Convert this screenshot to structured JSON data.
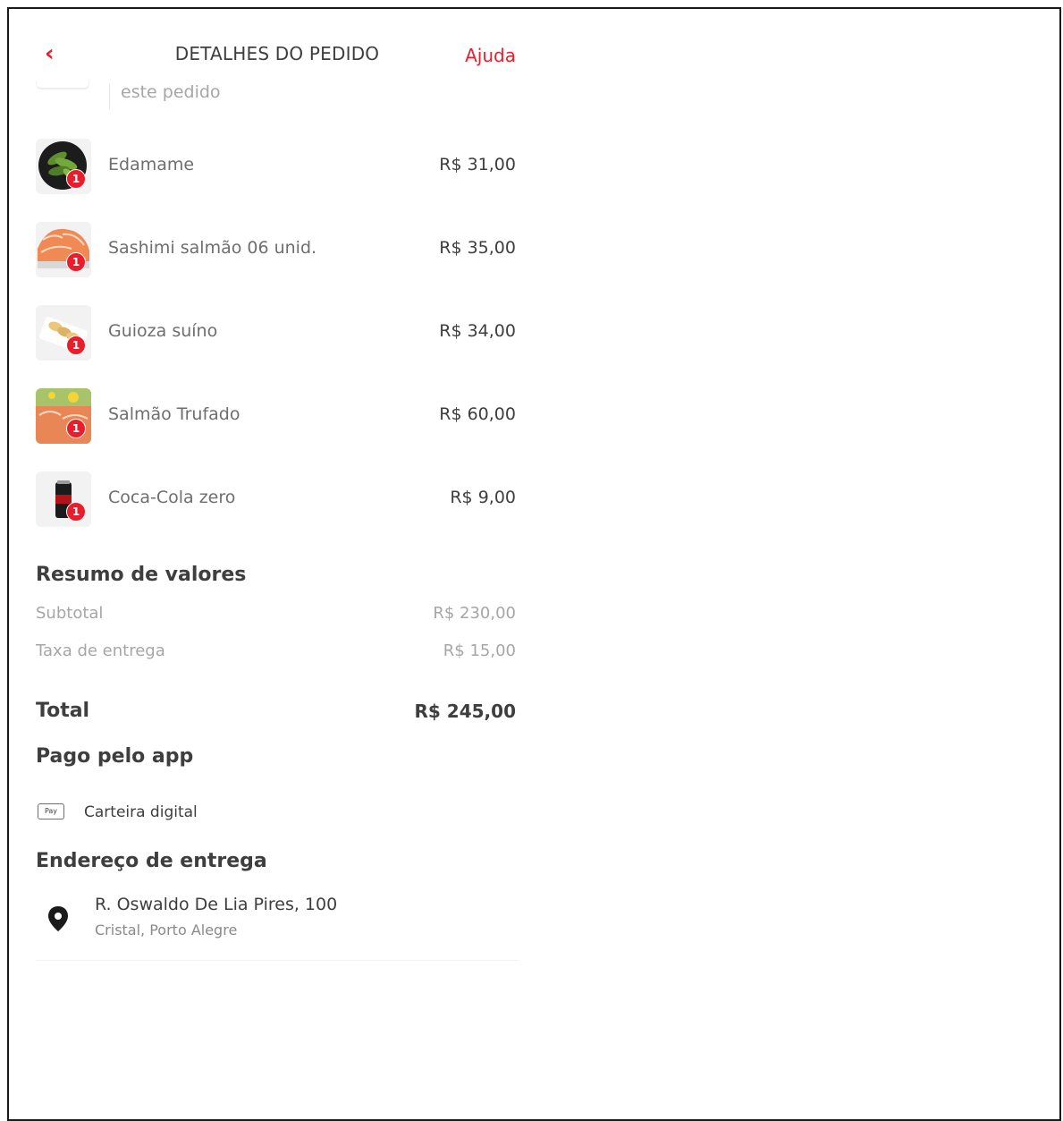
{
  "header": {
    "title": "DETALHES DO PEDIDO",
    "help_label": "Ajuda"
  },
  "partial_item": {
    "text": "este pedido"
  },
  "items": [
    {
      "name": "Edamame",
      "price": "R$ 31,00",
      "qty": "1",
      "icon": "edamame-image"
    },
    {
      "name": "Sashimi salmão 06 unid.",
      "price": "R$ 35,00",
      "qty": "1",
      "icon": "sashimi-image"
    },
    {
      "name": "Guioza suíno",
      "price": "R$ 34,00",
      "qty": "1",
      "icon": "guioza-image"
    },
    {
      "name": "Salmão Trufado",
      "price": "R$ 60,00",
      "qty": "1",
      "icon": "salmon-truffle-image"
    },
    {
      "name": "Coca-Cola zero",
      "price": "R$ 9,00",
      "qty": "1",
      "icon": "coke-can-image"
    }
  ],
  "summary": {
    "title": "Resumo de valores",
    "subtotal_label": "Subtotal",
    "subtotal_value": "R$ 230,00",
    "delivery_label": "Taxa de entrega",
    "delivery_value": "R$ 15,00",
    "total_label": "Total",
    "total_value": "R$ 245,00"
  },
  "payment": {
    "title": "Pago pelo app",
    "icon_text": "Pay",
    "method": "Carteira digital"
  },
  "address": {
    "title": "Endereço de entrega",
    "street": "R. Oswaldo De Lia Pires, 100",
    "district": "Cristal, Porto Alegre"
  },
  "colors": {
    "accent": "#ea1d2c",
    "text": "#3e3e3e",
    "muted": "#a6a6a6"
  }
}
